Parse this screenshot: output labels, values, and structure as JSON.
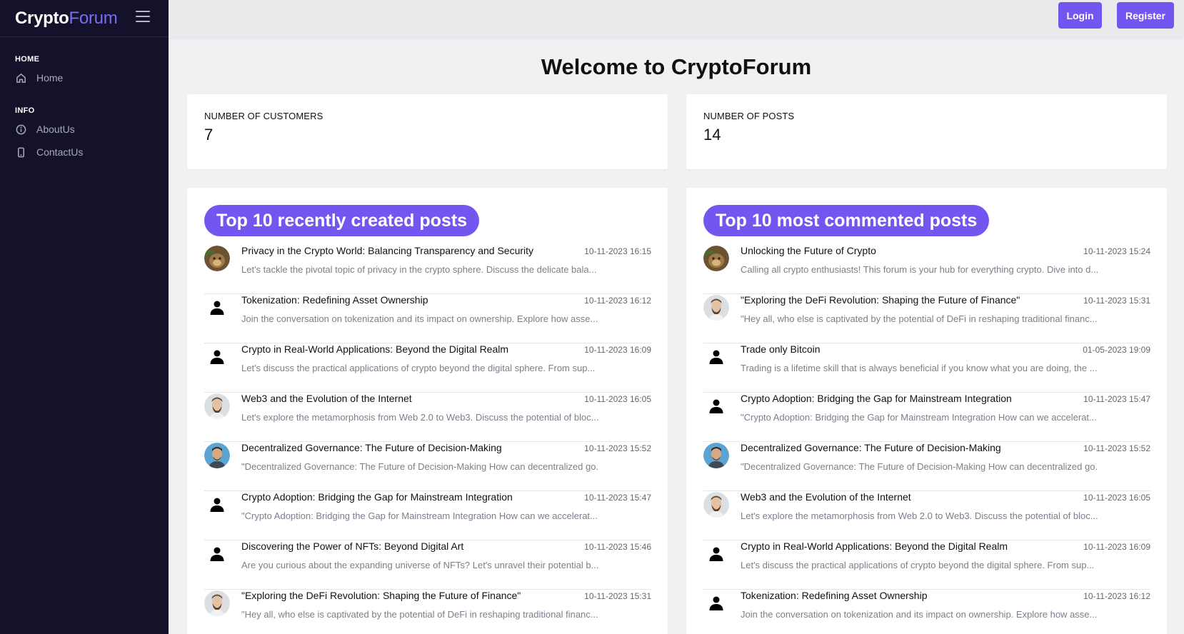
{
  "brand": {
    "name": "Crypto",
    "accent": "Forum"
  },
  "sidebar": {
    "sections": [
      {
        "heading": "HOME",
        "items": [
          {
            "label": "Home",
            "icon": "home-icon"
          }
        ]
      },
      {
        "heading": "INFO",
        "items": [
          {
            "label": "AboutUs",
            "icon": "info-icon"
          },
          {
            "label": "ContactUs",
            "icon": "phone-icon"
          }
        ]
      }
    ]
  },
  "header": {
    "login_label": "Login",
    "register_label": "Register"
  },
  "main": {
    "title": "Welcome to CryptoForum",
    "stats": {
      "customers_label": "NUMBER OF CUSTOMERS",
      "customers_value": "7",
      "posts_label": "NUMBER OF POSTS",
      "posts_value": "14"
    },
    "recent": {
      "title": "Top 10 recently created posts",
      "posts": [
        {
          "title": "Privacy in the Crypto World: Balancing Transparency and Security",
          "date": "10-11-2023 16:15",
          "excerpt": "Let's tackle the pivotal topic of privacy in the crypto sphere. Discuss the delicate bala...",
          "avatar": "monkey-avatar"
        },
        {
          "title": "Tokenization: Redefining Asset Ownership",
          "date": "10-11-2023 16:12",
          "excerpt": "Join the conversation on tokenization and its impact on ownership. Explore how asse...",
          "avatar": "user-icon"
        },
        {
          "title": "Crypto in Real-World Applications: Beyond the Digital Realm",
          "date": "10-11-2023 16:09",
          "excerpt": "Let's discuss the practical applications of crypto beyond the digital sphere. From sup...",
          "avatar": "user-icon"
        },
        {
          "title": "Web3 and the Evolution of the Internet",
          "date": "10-11-2023 16:05",
          "excerpt": "Let's explore the metamorphosis from Web 2.0 to Web3. Discuss the potential of bloc...",
          "avatar": "bearded-man-avatar"
        },
        {
          "title": "Decentralized Governance: The Future of Decision-Making",
          "date": "10-11-2023 15:52",
          "excerpt": "\"Decentralized Governance: The Future of Decision-Making How can decentralized go...",
          "avatar": "man-blue-bg-avatar"
        },
        {
          "title": "Crypto Adoption: Bridging the Gap for Mainstream Integration",
          "date": "10-11-2023 15:47",
          "excerpt": "\"Crypto Adoption: Bridging the Gap for Mainstream Integration How can we accelerat...",
          "avatar": "user-icon"
        },
        {
          "title": "Discovering the Power of NFTs: Beyond Digital Art",
          "date": "10-11-2023 15:46",
          "excerpt": "Are you curious about the expanding universe of NFTs? Let's unravel their potential b...",
          "avatar": "user-icon"
        },
        {
          "title": "\"Exploring the DeFi Revolution: Shaping the Future of Finance\"",
          "date": "10-11-2023 15:31",
          "excerpt": "\"Hey all, who else is captivated by the potential of DeFi in reshaping traditional financ...",
          "avatar": "bearded-man-avatar"
        }
      ]
    },
    "commented": {
      "title": "Top 10 most commented posts",
      "posts": [
        {
          "title": "Unlocking the Future of Crypto",
          "date": "10-11-2023 15:24",
          "excerpt": "Calling all crypto enthusiasts! This forum is your hub for everything crypto. Dive into d...",
          "avatar": "monkey-avatar"
        },
        {
          "title": "\"Exploring the DeFi Revolution: Shaping the Future of Finance\"",
          "date": "10-11-2023 15:31",
          "excerpt": "\"Hey all, who else is captivated by the potential of DeFi in reshaping traditional financ...",
          "avatar": "bearded-man-avatar"
        },
        {
          "title": "Trade only Bitcoin",
          "date": "01-05-2023 19:09",
          "excerpt": "Trading is a lifetime skill that is always beneficial if you know what you are doing, the ...",
          "avatar": "user-icon"
        },
        {
          "title": "Crypto Adoption: Bridging the Gap for Mainstream Integration",
          "date": "10-11-2023 15:47",
          "excerpt": "\"Crypto Adoption: Bridging the Gap for Mainstream Integration How can we accelerat...",
          "avatar": "user-icon"
        },
        {
          "title": "Decentralized Governance: The Future of Decision-Making",
          "date": "10-11-2023 15:52",
          "excerpt": "\"Decentralized Governance: The Future of Decision-Making How can decentralized go...",
          "avatar": "man-blue-bg-avatar"
        },
        {
          "title": "Web3 and the Evolution of the Internet",
          "date": "10-11-2023 16:05",
          "excerpt": "Let's explore the metamorphosis from Web 2.0 to Web3. Discuss the potential of bloc...",
          "avatar": "bearded-man-avatar"
        },
        {
          "title": "Crypto in Real-World Applications: Beyond the Digital Realm",
          "date": "10-11-2023 16:09",
          "excerpt": "Let's discuss the practical applications of crypto beyond the digital sphere. From sup...",
          "avatar": "user-icon"
        },
        {
          "title": "Tokenization: Redefining Asset Ownership",
          "date": "10-11-2023 16:12",
          "excerpt": "Join the conversation on tokenization and its impact on ownership. Explore how asse...",
          "avatar": "user-icon"
        }
      ]
    }
  },
  "colors": {
    "accent": "#7355ef",
    "sidebar_bg": "#13122a",
    "brand_accent": "#7c6cf0",
    "page_bg": "#f1f1f4"
  }
}
